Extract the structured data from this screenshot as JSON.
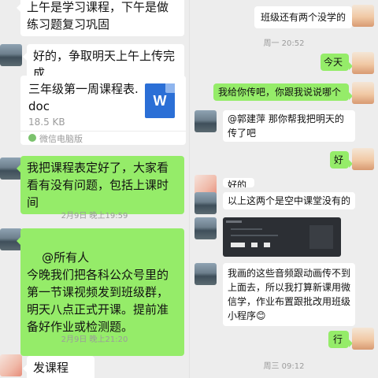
{
  "left": {
    "msg_top": "上午是学习课程，下午是做练习题复习巩固",
    "msg_upload": "好的，争取明天上午上传完成",
    "file": {
      "name": "三年级第一周课程表.doc",
      "size": "18.5 KB",
      "source": "微信电脑版",
      "icon_letter": "W"
    },
    "msg_schedule": "我把课程表定好了，大家看看有没有问题，包括上课时间",
    "time_1": "2月9日 晚上19:59",
    "msg_notice": "@所有人\n今晚我们把各科公众号里的第一节课视频发到班级群，明天八点正式开课。提前准备好作业或检测题。",
    "time_2": "2月9日 晚上21:20",
    "msg_last": "发课程吗？"
  },
  "right": {
    "msg_absent": "班级还有两个没学的",
    "time_1": "周一 20:52",
    "msg_today": "今天",
    "msg_send": "我给你传吧，你跟我说说哪个",
    "msg_ask": "@郭建萍  那你帮我把明天的传了吧",
    "msg_ok": "好",
    "msg_partial": "好的",
    "msg_air": "以上这两个是空中课堂没有的",
    "msg_audio": "我画的这些音频跟动画传不到上面去，所以我打算新课用微信学，作业布置跟批改用班级小程序😊",
    "msg_go": "行",
    "time_2": "周三 09:12"
  }
}
